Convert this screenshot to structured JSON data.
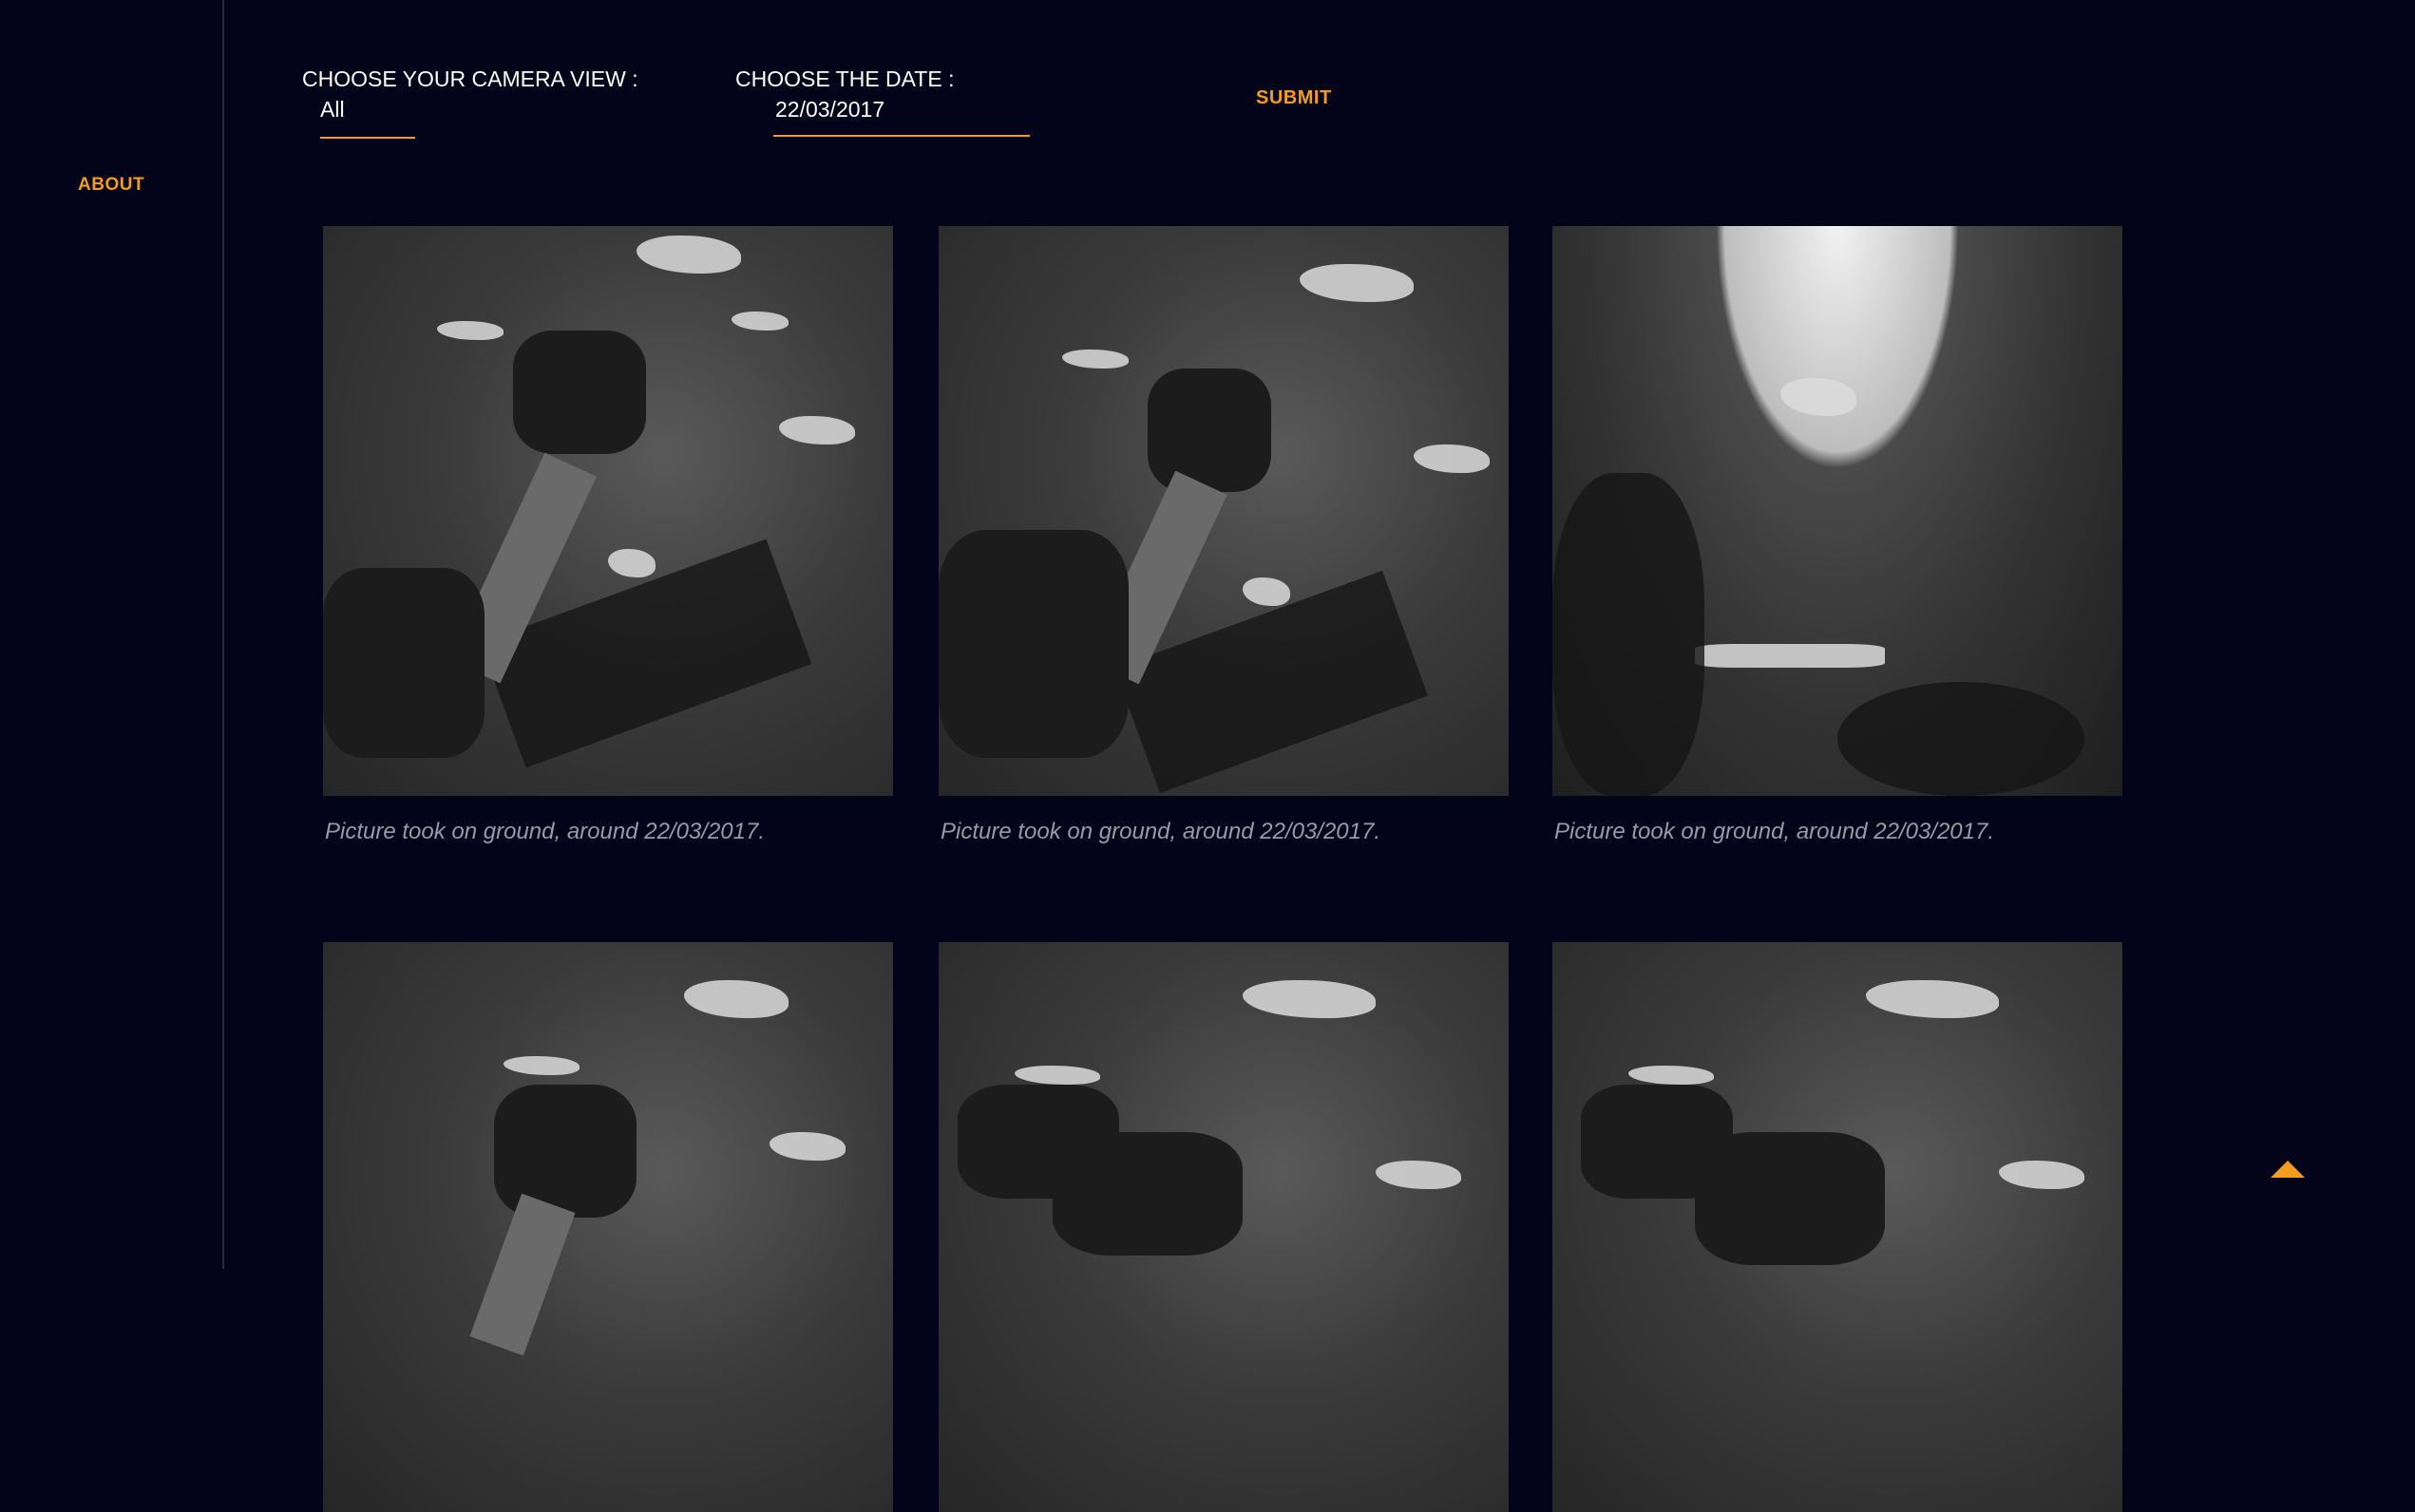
{
  "sidebar": {
    "about_label": "ABOUT"
  },
  "filters": {
    "camera_label": "CHOOSE YOUR CAMERA VIEW :",
    "camera_value": "All",
    "date_label": "CHOOSE THE DATE :",
    "date_value": "22/03/2017",
    "submit_label": "SUBMIT"
  },
  "gallery": {
    "captions": [
      "Picture took on ground, around 22/03/2017.",
      "Picture took on ground, around 22/03/2017.",
      "Picture took on ground, around 22/03/2017."
    ]
  },
  "colors": {
    "background": "#03031a",
    "accent": "#f39c1f",
    "caption": "#9a9aa6"
  },
  "icons": {
    "scroll_top": "caret-up-icon"
  }
}
